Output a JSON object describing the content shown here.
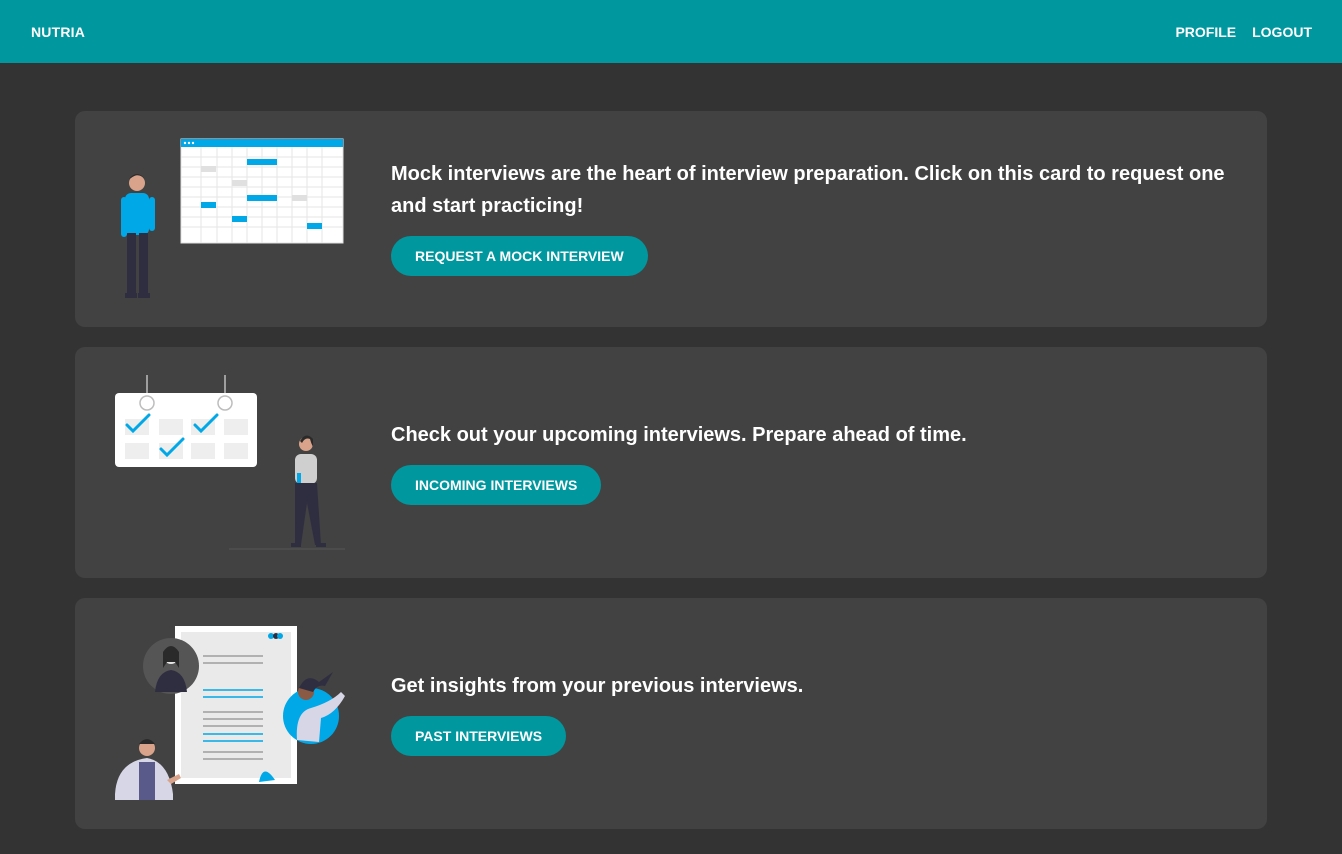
{
  "navbar": {
    "brand": "NUTRIA",
    "links": [
      "PROFILE",
      "LOGOUT"
    ]
  },
  "cards": [
    {
      "title": "Mock interviews are the heart of interview preparation. Click on this card to request one and start practicing!",
      "button": "REQUEST A MOCK INTERVIEW",
      "illustration": "person-with-schedule-board-illustration"
    },
    {
      "title": "Check out your upcoming interviews. Prepare ahead of time.",
      "button": "INCOMING INTERVIEWS",
      "illustration": "person-with-calendar-checks-illustration"
    },
    {
      "title": "Get insights from your previous interviews.",
      "button": "PAST INTERVIEWS",
      "illustration": "people-around-document-illustration"
    }
  ],
  "colors": {
    "accent": "#00979f",
    "page_bg": "#333333",
    "card_bg": "#424242",
    "illustration_blue": "#00a8e8"
  }
}
